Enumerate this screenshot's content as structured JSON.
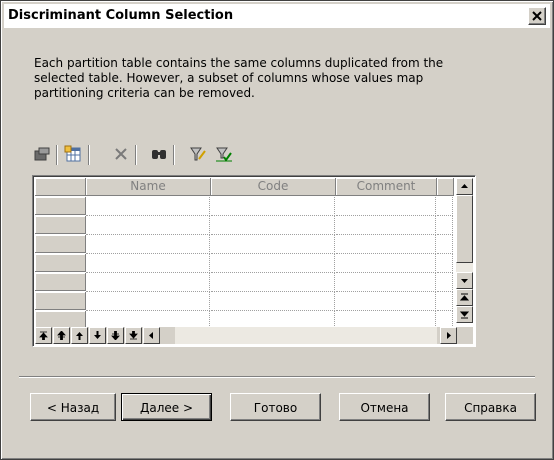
{
  "window": {
    "title": "Discriminant Column Selection"
  },
  "description": "Each partition table contains the same columns duplicated from the\nselected table. However, a subset of columns whose values map\npartitioning criteria can be removed.",
  "toolbar": {
    "icons": [
      "properties-icon",
      "add-columns-icon",
      "delete-icon",
      "find-icon",
      "filter-icon",
      "filter-apply-icon"
    ]
  },
  "grid": {
    "columns": [
      "Name",
      "Code",
      "Comment"
    ],
    "rows": [
      [
        "",
        "",
        ""
      ],
      [
        "",
        "",
        ""
      ],
      [
        "",
        "",
        ""
      ],
      [
        "",
        "",
        ""
      ],
      [
        "",
        "",
        ""
      ],
      [
        "",
        "",
        ""
      ],
      [
        "",
        "",
        ""
      ]
    ]
  },
  "buttons": {
    "back": "< Назад",
    "next": "Далее >",
    "finish": "Готово",
    "cancel": "Отмена",
    "help": "Справка"
  },
  "colors": {
    "dialog_bg": "#d4d0c8",
    "title_bg": "#ffffff",
    "header_text": "#808080"
  }
}
